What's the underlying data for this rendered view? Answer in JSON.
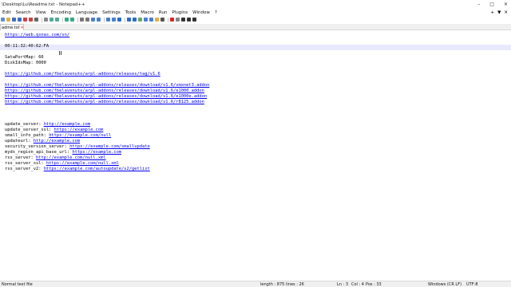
{
  "window": {
    "title": "\\Desktop\\Lu\\Readme.txt - Notepad++",
    "minimize": "–",
    "maximize": "□",
    "close": "✕"
  },
  "menu": {
    "items": [
      "Edit",
      "Search",
      "View",
      "Encoding",
      "Language",
      "Settings",
      "Tools",
      "Macro",
      "Run",
      "Plugins",
      "Window",
      "?"
    ],
    "right": [
      "+",
      "▼",
      "✕"
    ]
  },
  "tab": {
    "label": "adme.txt",
    "close": "✕"
  },
  "editor": {
    "lines": [
      {
        "text": "https://web.qxnas.com/sn/",
        "link": true
      },
      {
        "text": "",
        "link": false
      },
      {
        "text": "00:11:32:40:62:FA",
        "link": false
      },
      {
        "text": "",
        "link": false
      },
      {
        "text": "SataPortMap: 66",
        "link": false
      },
      {
        "text": "DiskIdxMap: 0000",
        "link": false
      },
      {
        "text": "",
        "link": false
      },
      {
        "text": "https://github.com/fbelavenuto/arpl-addons/releases/tag/v1.6",
        "link": true
      },
      {
        "text": "",
        "link": false
      },
      {
        "text": "https://github.com/fbelavenuto/arpl-addons/releases/download/v1.6/vmxnet3.addon",
        "link": true
      },
      {
        "text": "https://github.com/fbelavenuto/arpl-addons/releases/download/v1.6/e1000.addon",
        "link": true
      },
      {
        "text": "https://github.com/fbelavenuto/arpl-addons/releases/download/v1.6/e1000e.addon",
        "link": true
      },
      {
        "text": "https://github.com/fbelavenuto/arpl-addons/releases/download/v1.6/r8125.addon",
        "link": true
      },
      {
        "text": "",
        "link": false
      },
      {
        "text": "",
        "link": false
      },
      {
        "text": "",
        "link": false
      },
      {
        "key": "update_server: ",
        "url": "http://example.com"
      },
      {
        "key": "update_server_ssl: ",
        "url": "https://example.com"
      },
      {
        "key": "small_info_path: ",
        "url": "https://example.com/null"
      },
      {
        "key": "updateurl: ",
        "url": "http://example.com"
      },
      {
        "key": "security_version_server: ",
        "url": "https://example.com/smallupdate"
      },
      {
        "key": "myds_region_api_base_url: ",
        "url": "https://example.com"
      },
      {
        "key": "rss_server: ",
        "url": "http://example.com/null.xml"
      },
      {
        "key": "rss_server_ssl: ",
        "url": "https://example.com/null.xml"
      },
      {
        "key": "rss_server_v2: ",
        "url": "https://example.com/autoupdate/v2/getlist"
      }
    ]
  },
  "status": {
    "type": "Normal text file",
    "length": "length : 875",
    "lines": "lines : 26",
    "ln": "Ln : 3",
    "col": "Col : 4",
    "pos": "Pos : 33",
    "eol": "Windows (CR LF)",
    "encoding": "UTF-8"
  },
  "colors": {
    "link": "#0000ee",
    "current_line": "#e8e8ff",
    "tab_close": "#dd2222"
  },
  "toolbar_icons": [
    "new-file-icon",
    "open-file-icon",
    "save-icon",
    "save-all-icon",
    "close-icon",
    "close-all-icon",
    "print-icon",
    "cut-icon",
    "copy-icon",
    "paste-icon",
    "undo-icon",
    "redo-icon",
    "find-icon",
    "replace-icon",
    "zoom-in-icon",
    "zoom-out-icon",
    "sync-v-icon",
    "sync-h-icon",
    "word-wrap-icon",
    "all-chars-icon",
    "indent-guide-icon",
    "udl-icon",
    "doc-map-icon",
    "function-list-icon",
    "folder-workspace-icon",
    "monitor-icon",
    "record-icon",
    "stop-icon",
    "play-icon",
    "play-multi-icon",
    "save-macro-icon"
  ]
}
